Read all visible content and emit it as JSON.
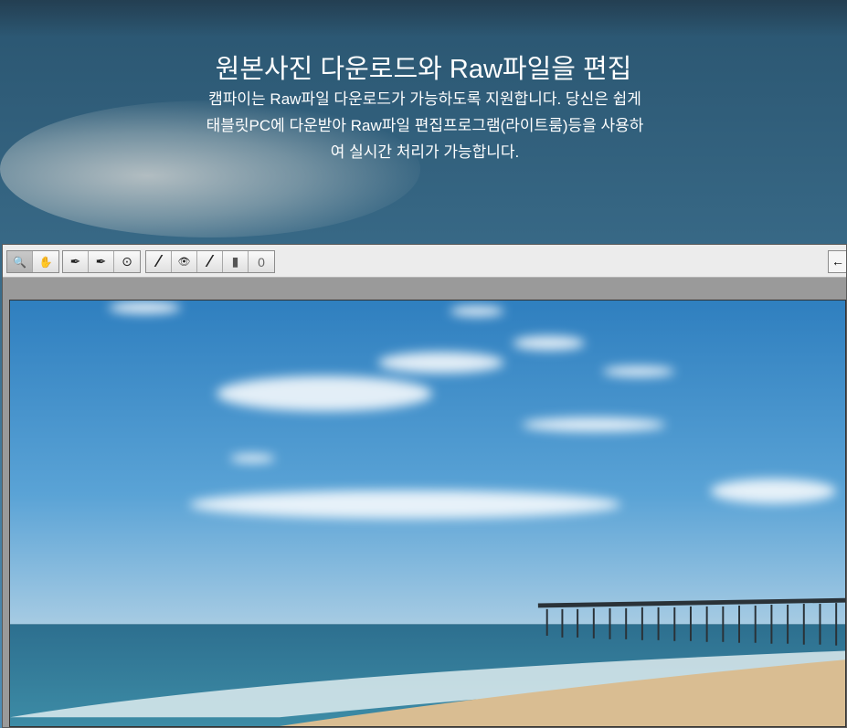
{
  "hero": {
    "title": "원본사진 다운로드와 Raw파일을 편집",
    "description": "캠파이는 Raw파일 다운로드가 가능하도록 지원합니다. 당신은 쉽게 태블릿PC에 다운받아 Raw파일 편집프로그램(라이트룸)등을 사용하여 실시간 처리가 가능합니다."
  },
  "toolbar": {
    "tools": [
      {
        "name": "zoom",
        "glyph": "🔍"
      },
      {
        "name": "hand",
        "glyph": "✋"
      },
      {
        "name": "eyedropper",
        "glyph": "✒"
      },
      {
        "name": "color-sampler",
        "glyph": "✒"
      },
      {
        "name": "target-adjustment",
        "glyph": "⊙"
      },
      {
        "name": "spot-removal",
        "glyph": "⁄"
      },
      {
        "name": "red-eye",
        "glyph": "👁"
      },
      {
        "name": "adjustment-brush",
        "glyph": "⁄"
      },
      {
        "name": "graduated-filter",
        "glyph": "▮"
      },
      {
        "name": "radial-filter",
        "glyph": "0"
      }
    ],
    "back_glyph": "←"
  }
}
